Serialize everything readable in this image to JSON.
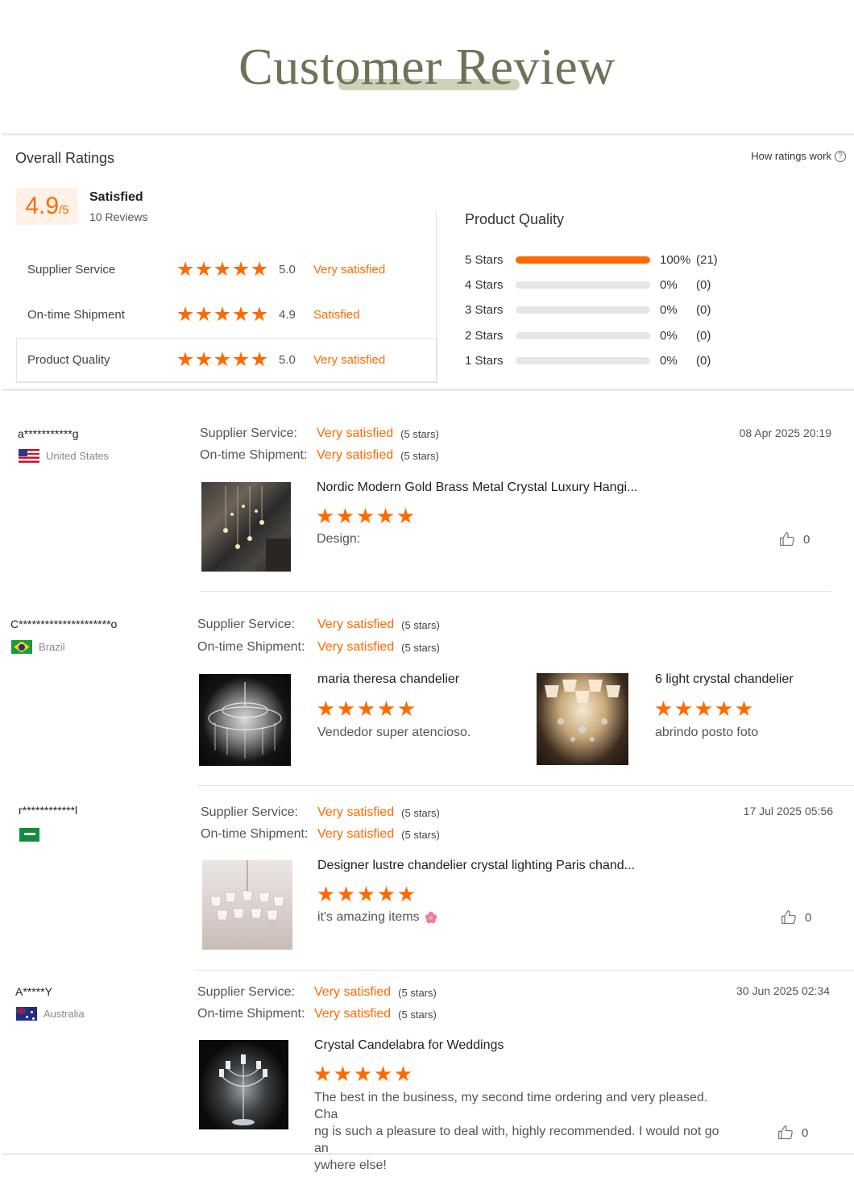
{
  "header": {
    "title": "Customer Review"
  },
  "overall": {
    "heading": "Overall Ratings",
    "how_ratings": "How ratings work",
    "score": "4.9",
    "score_denom": "/5",
    "sentiment": "Satisfied",
    "reviews": "10 Reviews",
    "rows": [
      {
        "label": "Supplier Service",
        "stars": 5,
        "value": "5.0",
        "text": "Very satisfied"
      },
      {
        "label": "On-time Shipment",
        "stars": 5,
        "value": "4.9",
        "text": "Satisfied"
      },
      {
        "label": "Product Quality",
        "stars": 5,
        "value": "5.0",
        "text": "Very satisfied"
      }
    ]
  },
  "product_quality": {
    "heading": "Product Quality",
    "bars": [
      {
        "label": "5 Stars",
        "percent": 100,
        "pct_text": "100%",
        "count": "(21)"
      },
      {
        "label": "4 Stars",
        "percent": 0,
        "pct_text": "0%",
        "count": "(0)"
      },
      {
        "label": "3 Stars",
        "percent": 0,
        "pct_text": "0%",
        "count": "(0)"
      },
      {
        "label": "2 Stars",
        "percent": 0,
        "pct_text": "0%",
        "count": "(0)"
      },
      {
        "label": "1 Stars",
        "percent": 0,
        "pct_text": "0%",
        "count": "(0)"
      }
    ]
  },
  "labels": {
    "supplier_service": "Supplier Service:",
    "ontime_shipment": "On-time Shipment:",
    "very_satisfied": "Very satisfied",
    "five_stars": "(5 stars)"
  },
  "reviews": [
    {
      "name": "a***********g",
      "country": "United States",
      "date": "08 Apr 2025 20:19",
      "products": [
        {
          "title": "Nordic Modern Gold Brass Metal Crystal Luxury Hangi...",
          "rating": 5,
          "text": "Design:"
        }
      ],
      "likes": "0"
    },
    {
      "name": "C*********************o",
      "country": "Brazil",
      "date": "",
      "products": [
        {
          "title": "maria theresa chandelier",
          "rating": 5,
          "text": "Vendedor super atencioso."
        },
        {
          "title": "6 light crystal chandelier",
          "rating": 5,
          "text": "abrindo posto foto"
        }
      ],
      "likes": ""
    },
    {
      "name": "r************l",
      "country": "",
      "date": "17 Jul 2025 05:56",
      "products": [
        {
          "title": "Designer lustre chandelier crystal lighting Paris chand...",
          "rating": 5,
          "text": "it's amazing items"
        }
      ],
      "likes": "0"
    },
    {
      "name": "A*****Y",
      "country": "Australia",
      "date": "30 Jun 2025 02:34",
      "products": [
        {
          "title": "Crystal Candelabra for Weddings",
          "rating": 5,
          "text_lines": [
            "The best in the business, my second time ordering and very pleased. Cha",
            "ng is such a pleasure to deal with, highly recommended. I would not go an",
            "ywhere else!"
          ]
        }
      ],
      "likes": "0"
    }
  ],
  "colors": {
    "accent": "#ff6a00",
    "title": "#6e7257",
    "underline": "#b9c3a0"
  }
}
